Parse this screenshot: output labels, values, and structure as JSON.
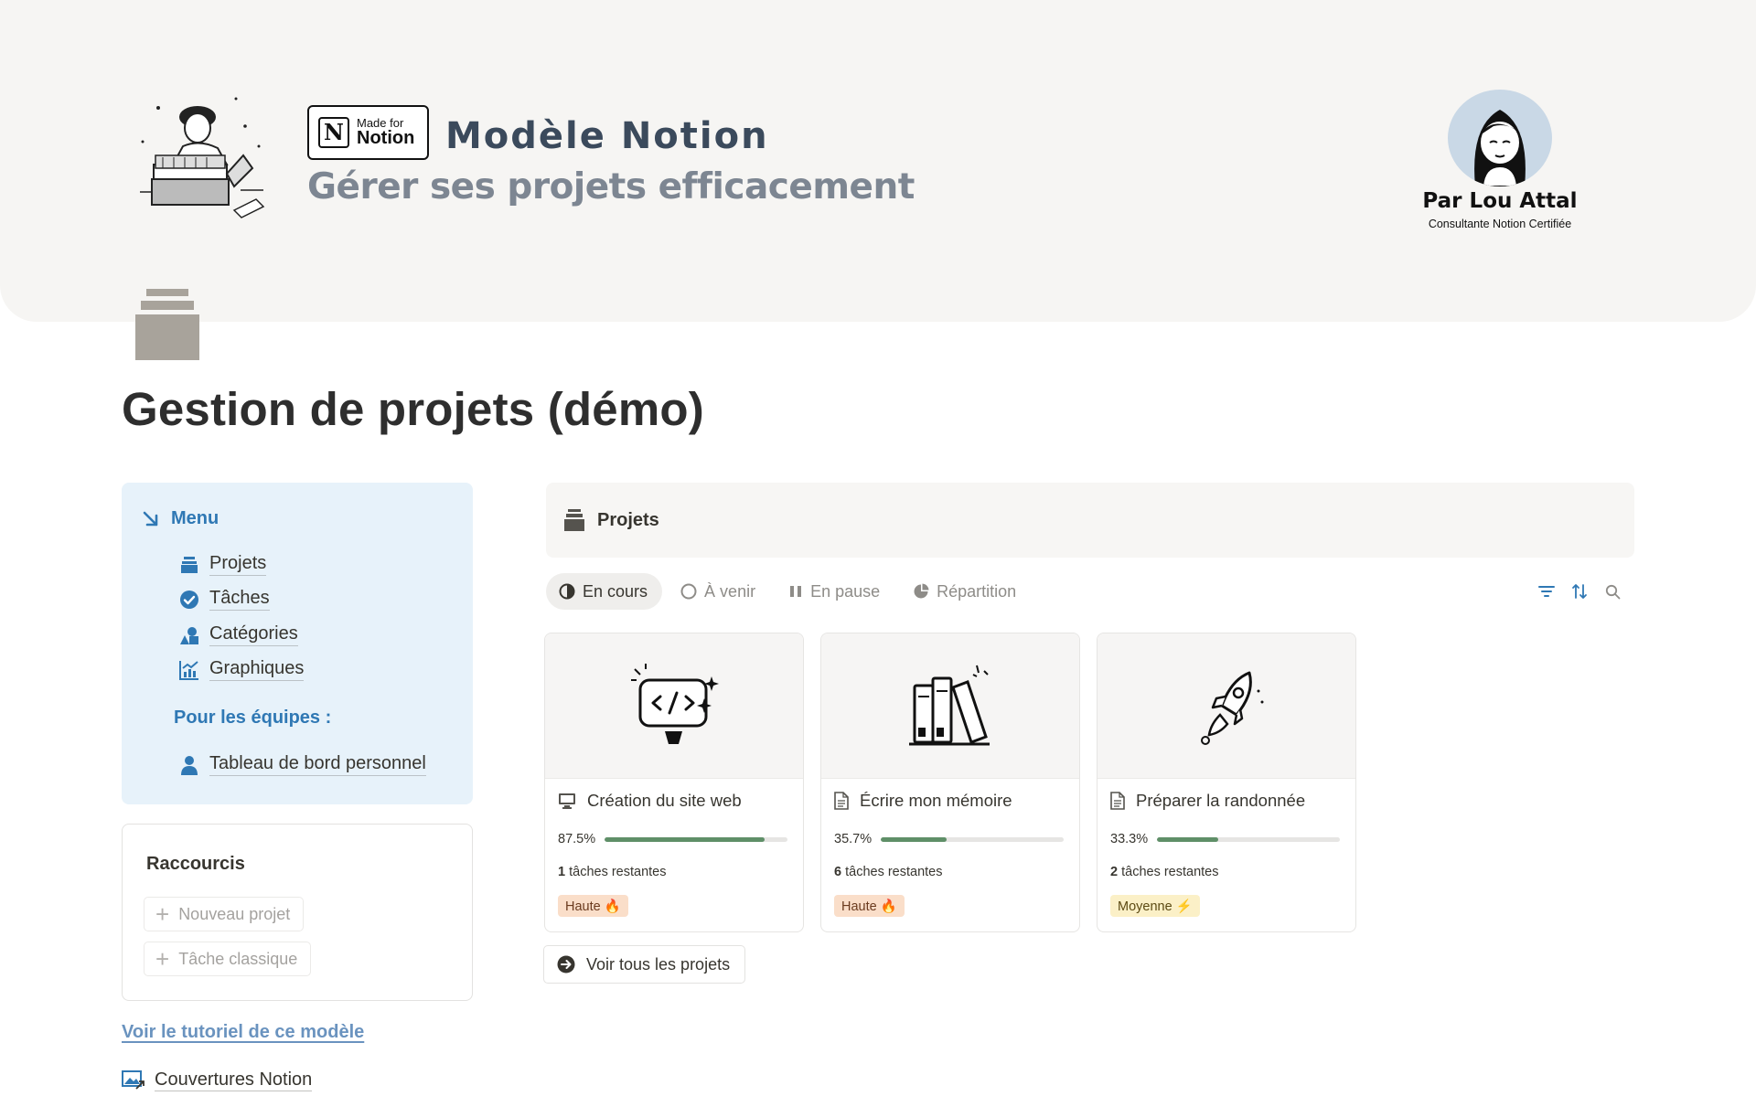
{
  "cover": {
    "badge_small": "Made for",
    "badge_big": "Notion",
    "title": "Modèle Notion",
    "subtitle": "Gérer ses projets efficacement",
    "author_name": "Par Lou Attal",
    "author_role": "Consultante Notion Certifiée"
  },
  "page": {
    "title": "Gestion de projets (démo)"
  },
  "menu": {
    "title": "Menu",
    "items": [
      {
        "label": "Projets",
        "icon": "archive-icon"
      },
      {
        "label": "Tâches",
        "icon": "check-circle-icon"
      },
      {
        "label": "Catégories",
        "icon": "shapes-icon"
      },
      {
        "label": "Graphiques",
        "icon": "chart-icon"
      }
    ],
    "teams_title": "Pour les équipes :",
    "teams_items": [
      {
        "label": "Tableau de bord personnel",
        "icon": "person-icon"
      }
    ]
  },
  "shortcuts": {
    "title": "Raccourcis",
    "buttons": [
      {
        "label": "Nouveau projet"
      },
      {
        "label": "Tâche classique"
      }
    ]
  },
  "links": {
    "tutorial": "Voir le tutoriel de ce modèle",
    "covers": "Couvertures Notion"
  },
  "projects": {
    "title": "Projets",
    "tabs": [
      {
        "label": "En cours",
        "active": true
      },
      {
        "label": "À venir",
        "active": false
      },
      {
        "label": "En pause",
        "active": false
      },
      {
        "label": "Répartition",
        "active": false
      }
    ],
    "cards": [
      {
        "title": "Création du site web",
        "icon": "monitor-icon",
        "progress_label": "87.5%",
        "progress": 0.875,
        "tasks_count": "1",
        "tasks_suffix": " tâches restantes",
        "priority": "Haute 🔥",
        "priority_bg": "#fadec9",
        "priority_color": "#6b3b1f"
      },
      {
        "title": "Écrire mon mémoire",
        "icon": "document-icon",
        "progress_label": "35.7%",
        "progress": 0.357,
        "tasks_count": "6",
        "tasks_suffix": " tâches restantes",
        "priority": "Haute 🔥",
        "priority_bg": "#fadec9",
        "priority_color": "#6b3b1f"
      },
      {
        "title": "Préparer la randonnée",
        "icon": "document-icon",
        "progress_label": "33.3%",
        "progress": 0.333,
        "tasks_count": "2",
        "tasks_suffix": " tâches restantes",
        "priority": "Moyenne ⚡",
        "priority_bg": "#fbf0c7",
        "priority_color": "#5c4a13"
      }
    ],
    "see_all": "Voir tous les projets"
  },
  "colors": {
    "accent_blue": "#2f78b4",
    "progress_green": "#5f8f68",
    "callout_bg": "#e7f2fa"
  }
}
